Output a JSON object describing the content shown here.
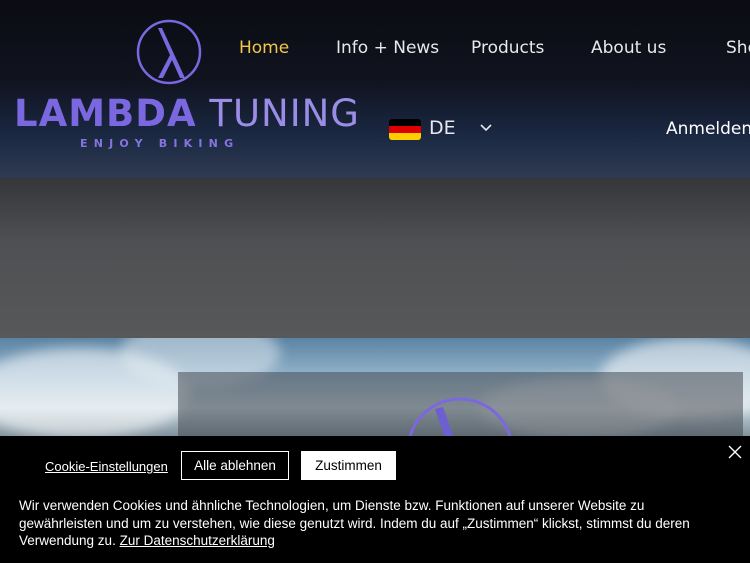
{
  "brand": {
    "name_bold": "LAMBDA",
    "name_light": "TUNING",
    "tagline": "ENJOY BIKING",
    "logo_icon": "lambda-logo-icon",
    "colors": {
      "logo": "#7b68e0",
      "nav_active": "#f1c84a"
    }
  },
  "nav": {
    "items": [
      {
        "label": "Home",
        "active": true
      },
      {
        "label": "Info + News",
        "active": false
      },
      {
        "label": "Products",
        "active": false
      },
      {
        "label": "About us",
        "active": false
      },
      {
        "label": "Sho",
        "active": false
      }
    ]
  },
  "language": {
    "code": "DE",
    "flag_icon": "germany-flag-icon",
    "chevron_icon": "chevron-down-icon"
  },
  "login": {
    "label": "Anmelden"
  },
  "cookie_banner": {
    "settings_label": "Cookie-Einstellungen",
    "reject_label": "Alle ablehnen",
    "accept_label": "Zustimmen",
    "close_icon": "close-icon",
    "text": "Wir verwenden Cookies und ähnliche Technologien, um Dienste bzw. Funktionen auf unserer Website zu gewährleisten und um zu verstehen, wie diese genutzt wird. Indem du auf „Zustimmen“ klickst, stimmst du deren Verwendung zu. ",
    "link_label": "Zur Datenschutzerklärung"
  }
}
